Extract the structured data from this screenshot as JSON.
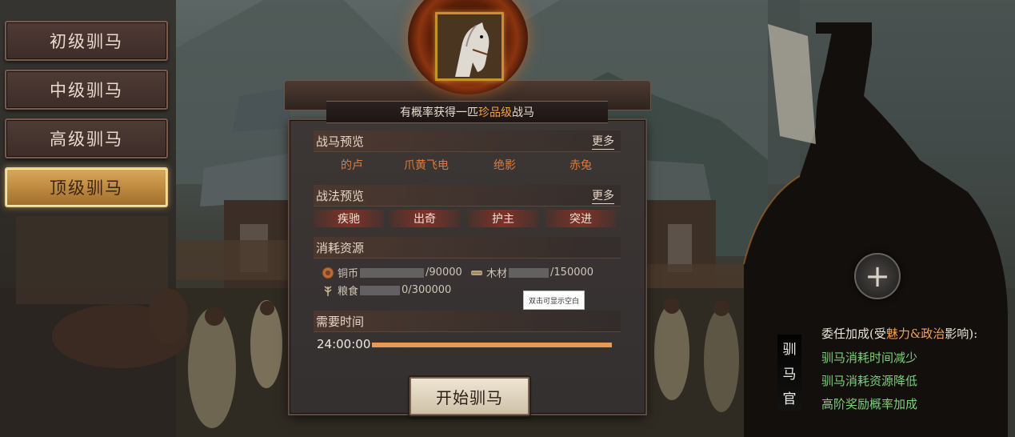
{
  "tiers": [
    {
      "label": "初级驯马",
      "active": false
    },
    {
      "label": "中级驯马",
      "active": false
    },
    {
      "label": "高级驯马",
      "active": false
    },
    {
      "label": "顶级驯马",
      "active": true
    }
  ],
  "banner": {
    "prefix": "有概率获得一匹",
    "highlight": "珍品级",
    "suffix": "战马"
  },
  "horse_preview": {
    "title": "战马预览",
    "more": "更多",
    "horses": [
      "的卢",
      "爪黄飞电",
      "绝影",
      "赤兔"
    ]
  },
  "skill_preview": {
    "title": "战法预览",
    "more": "更多",
    "skills": [
      "疾驰",
      "出奇",
      "护主",
      "突进"
    ]
  },
  "resources": {
    "title": "消耗资源",
    "copper": {
      "name": "铜币",
      "required": "/90000"
    },
    "wood": {
      "name": "木材",
      "required": "/150000"
    },
    "food": {
      "name": "粮食",
      "required": "0/300000"
    }
  },
  "time": {
    "title": "需要时间",
    "value": "24:00:00",
    "progress": 1.0
  },
  "start_button": "开始驯马",
  "tooltip": "双击可显示空白",
  "officer": {
    "label": [
      "驯",
      "马",
      "官"
    ],
    "bonus_title_prefix": "委任加成(受",
    "bonus_title_highlight": "魅力&政治",
    "bonus_title_suffix": "影响):",
    "bonuses": [
      "驯马消耗时间减少",
      "驯马消耗资源降低",
      "高阶奖励概率加成"
    ]
  },
  "colors": {
    "accent_orange": "#e07a3a",
    "bonus_green": "#7fd07a",
    "active_gold": "#d9a95a"
  }
}
